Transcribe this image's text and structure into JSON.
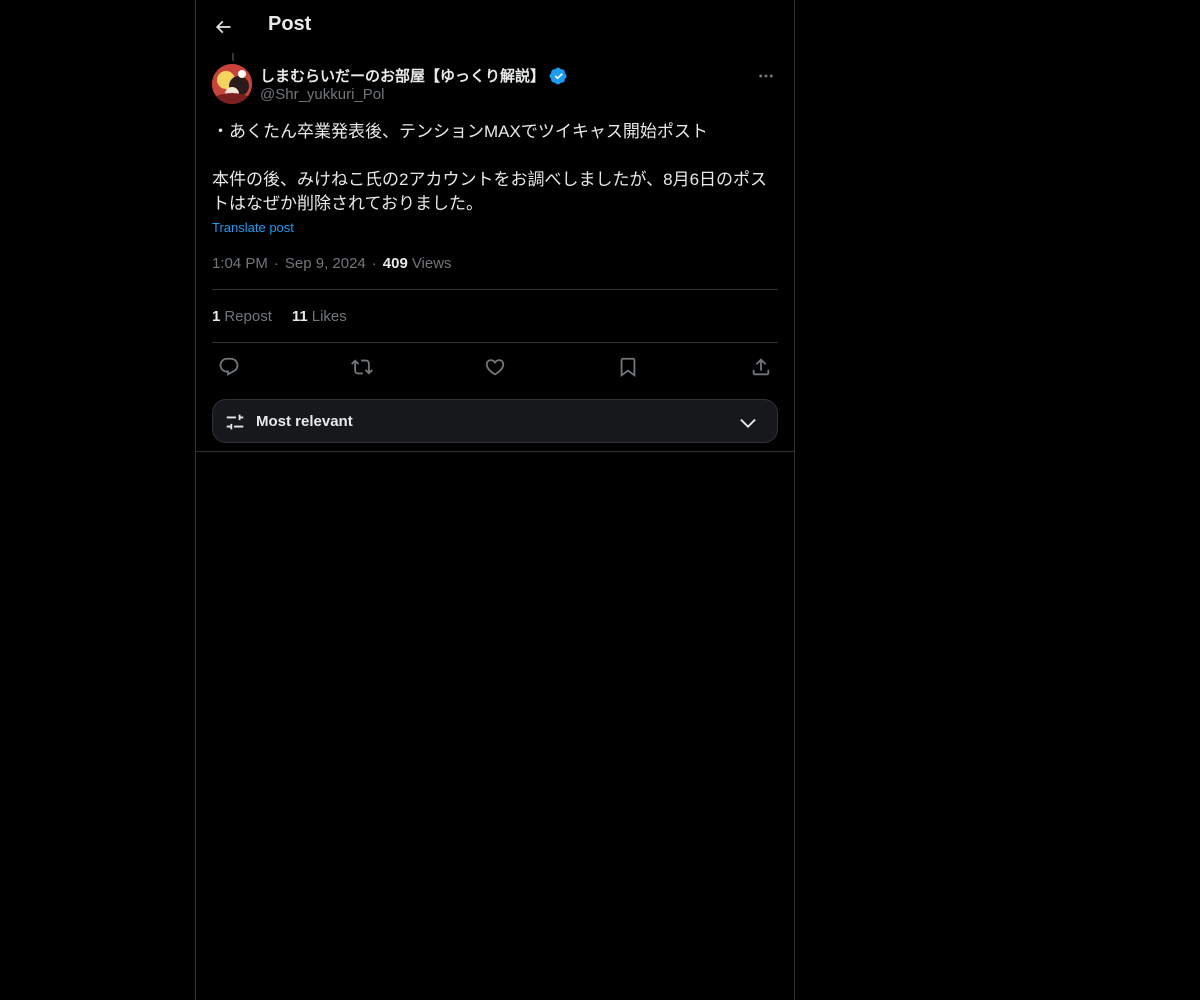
{
  "header": {
    "title": "Post"
  },
  "post": {
    "display_name": "しまむらいだーのお部屋【ゆっくり解説】",
    "handle": "@Shr_yukkuri_Pol",
    "text_line1": "・あくたん卒業発表後、テンションMAXでツイキャス開始ポスト",
    "text_line2": "本件の後、みけねこ氏の2アカウントをお調べしましたが、8月6日のポストはなぜか削除されておりました。",
    "translate_label": "Translate post",
    "time": "1:04 PM",
    "date": "Sep 9, 2024",
    "views_count": "409",
    "views_label": "Views",
    "meta_separator": "·"
  },
  "stats": {
    "reposts_count": "1",
    "reposts_label": "Repost",
    "likes_count": "11",
    "likes_label": "Likes"
  },
  "actions": {
    "icons": [
      "reply-icon",
      "repost-icon",
      "like-icon",
      "bookmark-icon",
      "share-icon"
    ]
  },
  "sort": {
    "label": "Most relevant"
  },
  "colors": {
    "background": "#000000",
    "text": "#e7e9ea",
    "muted": "#71767b",
    "accent": "#1d9bf0",
    "border": "#2f3336"
  }
}
